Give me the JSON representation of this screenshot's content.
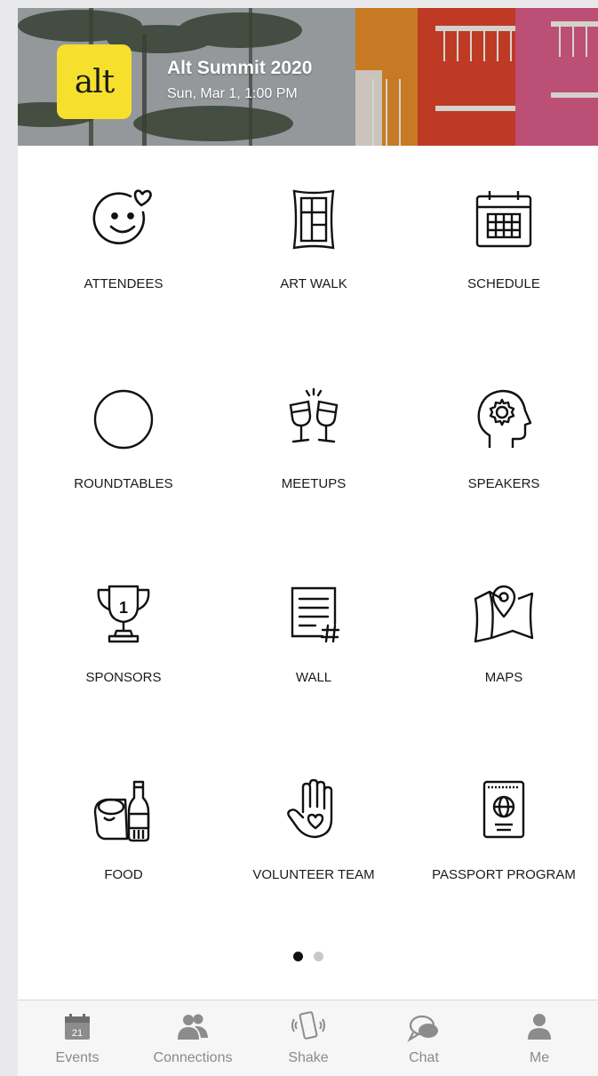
{
  "header": {
    "logo_text": "alt",
    "title": "Alt Summit 2020",
    "date": "Sun, Mar 1, 1:00 PM"
  },
  "menu": [
    {
      "label": "ATTENDEES",
      "icon": "smiley-heart-icon"
    },
    {
      "label": "ART WALK",
      "icon": "framed-art-icon"
    },
    {
      "label": "SCHEDULE",
      "icon": "calendar-icon"
    },
    {
      "label": "ROUNDTABLES",
      "icon": "circle-table-icon"
    },
    {
      "label": "MEETUPS",
      "icon": "cheers-glasses-icon"
    },
    {
      "label": "SPEAKERS",
      "icon": "head-gear-icon"
    },
    {
      "label": "SPONSORS",
      "icon": "trophy-icon"
    },
    {
      "label": "WALL",
      "icon": "hashtag-note-icon"
    },
    {
      "label": "MAPS",
      "icon": "map-pin-icon"
    },
    {
      "label": "FOOD",
      "icon": "burrito-soda-icon"
    },
    {
      "label": "VOLUNTEER TEAM",
      "icon": "hand-heart-icon"
    },
    {
      "label": "PASSPORT PROGRAM",
      "icon": "passport-icon"
    }
  ],
  "pager": {
    "active_color": "#111111",
    "inactive_color": "#c8c8cc",
    "current": 1,
    "total": 2
  },
  "tabs": [
    {
      "label": "Events",
      "icon": "calendar-tab-icon",
      "calendar_day": "21"
    },
    {
      "label": "Connections",
      "icon": "people-icon"
    },
    {
      "label": "Shake",
      "icon": "phone-shake-icon"
    },
    {
      "label": "Chat",
      "icon": "chat-bubble-icon"
    },
    {
      "label": "Me",
      "icon": "person-icon"
    }
  ],
  "colors": {
    "logo_bg": "#f6e02d",
    "tab_icon": "#8c8c8c"
  }
}
